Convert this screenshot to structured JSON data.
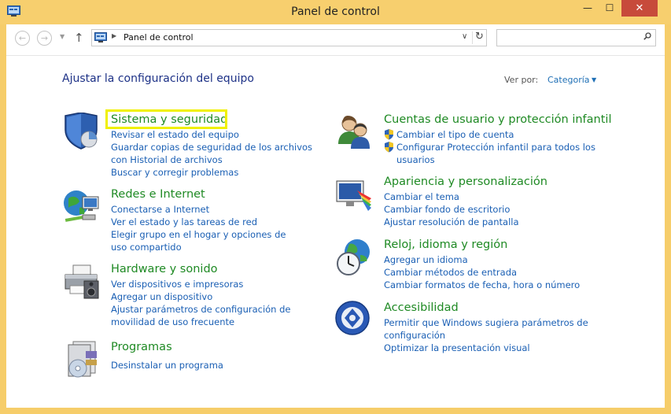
{
  "window": {
    "title": "Panel de control",
    "close_glyph": "✕",
    "max_glyph": "☐",
    "min_glyph": "—"
  },
  "nav": {
    "back_glyph": "←",
    "forward_glyph": "→",
    "recent_glyph": "▼",
    "up_glyph": "↑",
    "address": "Panel de control",
    "address_arrow": "▶",
    "dropdown_glyph": "∨",
    "refresh_glyph": "↻",
    "search_placeholder": ""
  },
  "main": {
    "heading": "Ajustar la configuración del equipo",
    "view_by_label": "Ver por:",
    "view_by_value": "Categoría",
    "view_by_arrow": "▼"
  },
  "categories_left": [
    {
      "title": "Sistema y seguridad",
      "icon": "shield-icon",
      "links": [
        "Revisar el estado del equipo",
        "Guardar copias de seguridad de los archivos con Historial de archivos",
        "Buscar y corregir problemas"
      ]
    },
    {
      "title": "Redes e Internet",
      "icon": "network-icon",
      "links": [
        "Conectarse a Internet",
        "Ver el estado y las tareas de red",
        "Elegir grupo en el hogar y opciones de uso compartido"
      ]
    },
    {
      "title": "Hardware y sonido",
      "icon": "printer-icon",
      "links": [
        "Ver dispositivos e impresoras",
        "Agregar un dispositivo",
        "Ajustar parámetros de configuración de movilidad de uso frecuente"
      ]
    },
    {
      "title": "Programas",
      "icon": "programs-icon",
      "links": [
        "Desinstalar un programa"
      ]
    }
  ],
  "categories_right": [
    {
      "title": "Cuentas de usuario y protección infantil",
      "icon": "users-icon",
      "links": [
        "Cambiar el tipo de cuenta",
        "Configurar Protección infantil para todos los usuarios"
      ]
    },
    {
      "title": "Apariencia y personalización",
      "icon": "monitor-icon",
      "links": [
        "Cambiar el tema",
        "Cambiar fondo de escritorio",
        "Ajustar resolución de pantalla"
      ]
    },
    {
      "title": "Reloj, idioma y región",
      "icon": "clock-globe-icon",
      "links": [
        "Agregar un idioma",
        "Cambiar métodos de entrada",
        "Cambiar formatos de fecha, hora o número"
      ]
    },
    {
      "title": "Accesibilidad",
      "icon": "accessibility-icon",
      "links": [
        "Permitir que Windows sugiera parámetros de configuración",
        "Optimizar la presentación visual"
      ]
    }
  ]
}
